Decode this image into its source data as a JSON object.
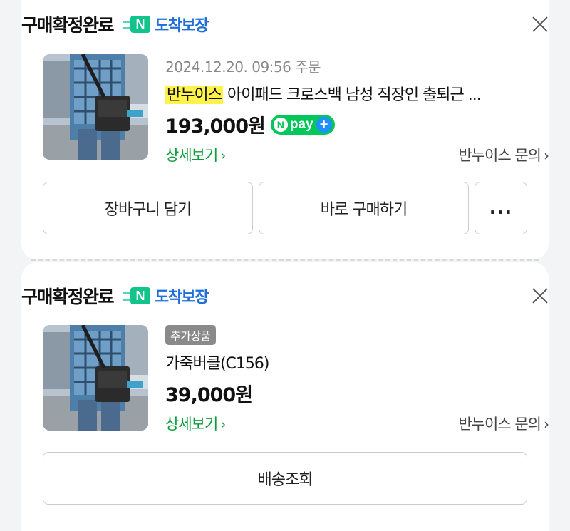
{
  "orders": [
    {
      "status": "구매확정완료",
      "badge_letter": "N",
      "badge_text": "도착보장",
      "date": "2024.12.20. 09:56 주문",
      "seller_highlight": "반누이스",
      "product_name": " 아이패드 크로스백 남성 직장인 출퇴근 ...",
      "price": "193,000원",
      "npay_label": "pay",
      "detail_label": "상세보기",
      "inquiry_label": "반누이스 문의",
      "buttons": {
        "cart": "장바구니 담기",
        "buy_now": "바로 구매하기",
        "more": "..."
      }
    },
    {
      "status": "구매확정완료",
      "badge_letter": "N",
      "badge_text": "도착보장",
      "tag": "추가상품",
      "product_name": "가죽버클(C156)",
      "price": "39,000원",
      "detail_label": "상세보기",
      "inquiry_label": "반누이스 문의",
      "buttons": {
        "tracking": "배송조회"
      }
    }
  ],
  "icons": {
    "close": "close-icon",
    "chevron": "chevron-right-icon",
    "badge": "delivery-badge-icon",
    "npay": "npay-plus-icon"
  },
  "colors": {
    "accent_green": "#0a9e3a",
    "badge_blue": "#1f6fdb",
    "npay_green": "#03c75a",
    "highlight_yellow": "#fff24a"
  }
}
